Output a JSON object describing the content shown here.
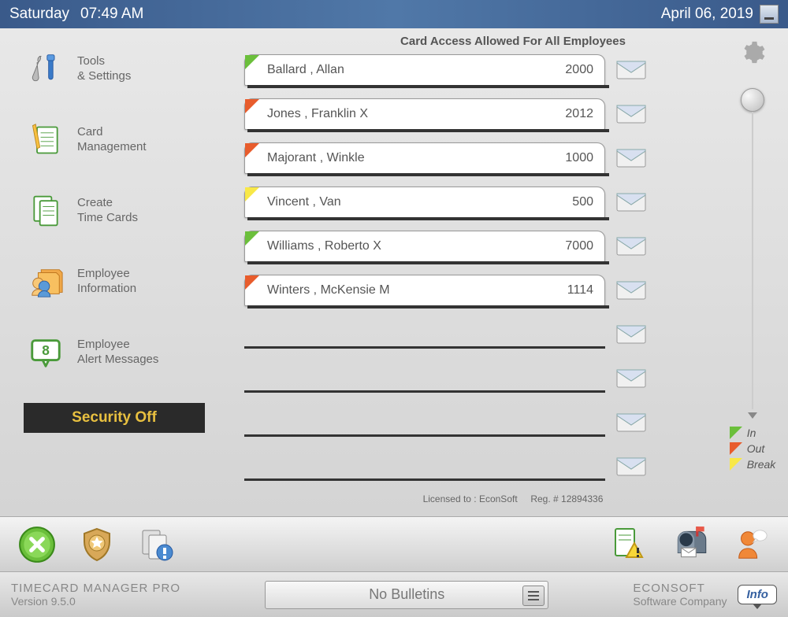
{
  "header": {
    "day": "Saturday",
    "time": "07:49 AM",
    "date": "April 06, 2019"
  },
  "sidebar": {
    "items": [
      {
        "label": "Tools\n& Settings"
      },
      {
        "label": "Card\nManagement"
      },
      {
        "label": "Create\nTime Cards"
      },
      {
        "label": "Employee\nInformation"
      },
      {
        "label": "Employee\nAlert Messages",
        "badge": "8"
      }
    ],
    "security": "Security Off"
  },
  "content": {
    "title": "Card Access Allowed For All Employees",
    "employees": [
      {
        "name": "Ballard , Allan",
        "id": "2000",
        "status": "green"
      },
      {
        "name": "Jones , Franklin X",
        "id": "2012",
        "status": "red"
      },
      {
        "name": "Majorant , Winkle",
        "id": "1000",
        "status": "red"
      },
      {
        "name": "Vincent , Van",
        "id": "500",
        "status": "yellow"
      },
      {
        "name": "Williams , Roberto X",
        "id": "7000",
        "status": "green"
      },
      {
        "name": "Winters , McKensie M",
        "id": "1114",
        "status": "red"
      }
    ],
    "legend": {
      "in": "In",
      "out": "Out",
      "break": "Break"
    },
    "license_to": "Licensed to : EconSoft",
    "reg": "Reg. # 12894336"
  },
  "footer": {
    "product": "TIMECARD MANAGER PRO",
    "version": "Version 9.5.0",
    "bulletin": "No Bulletins",
    "company": "ECONSOFT",
    "company_sub": "Software Company",
    "info": "Info"
  }
}
